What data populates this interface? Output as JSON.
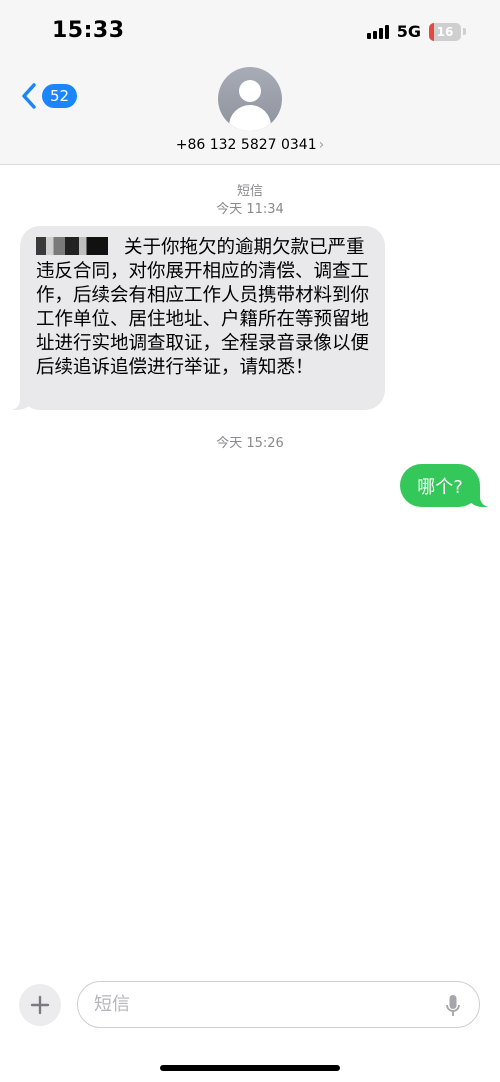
{
  "status_bar": {
    "time": "15:33",
    "network": "5G",
    "battery_level": "16",
    "battery_fraction": 0.16,
    "battery_color": "#e5483f"
  },
  "header": {
    "back_badge": "52",
    "contact_number": "+86 132 5827 0341",
    "contact_chevron": "›",
    "accent_color": "#1b84ff"
  },
  "conversation": {
    "service_label": "短信",
    "first_timestamp": "今天 11:34",
    "incoming_message": "关于你拖欠的逾期欠款已严重违反合同，对你展开相应的清偿、调查工作，后续会有相应工作人员携带材料到你工作单位、居住地址、户籍所在等预留地址进行实地调查取证，全程录音录像以便后续追诉追偿进行举证，请知悉！",
    "second_timestamp": "今天 15:26",
    "outgoing_message": "哪个?",
    "outgoing_color": "#34c759"
  },
  "composer": {
    "placeholder": "短信",
    "add_icon": "plus-icon",
    "mic_icon": "microphone-icon"
  }
}
